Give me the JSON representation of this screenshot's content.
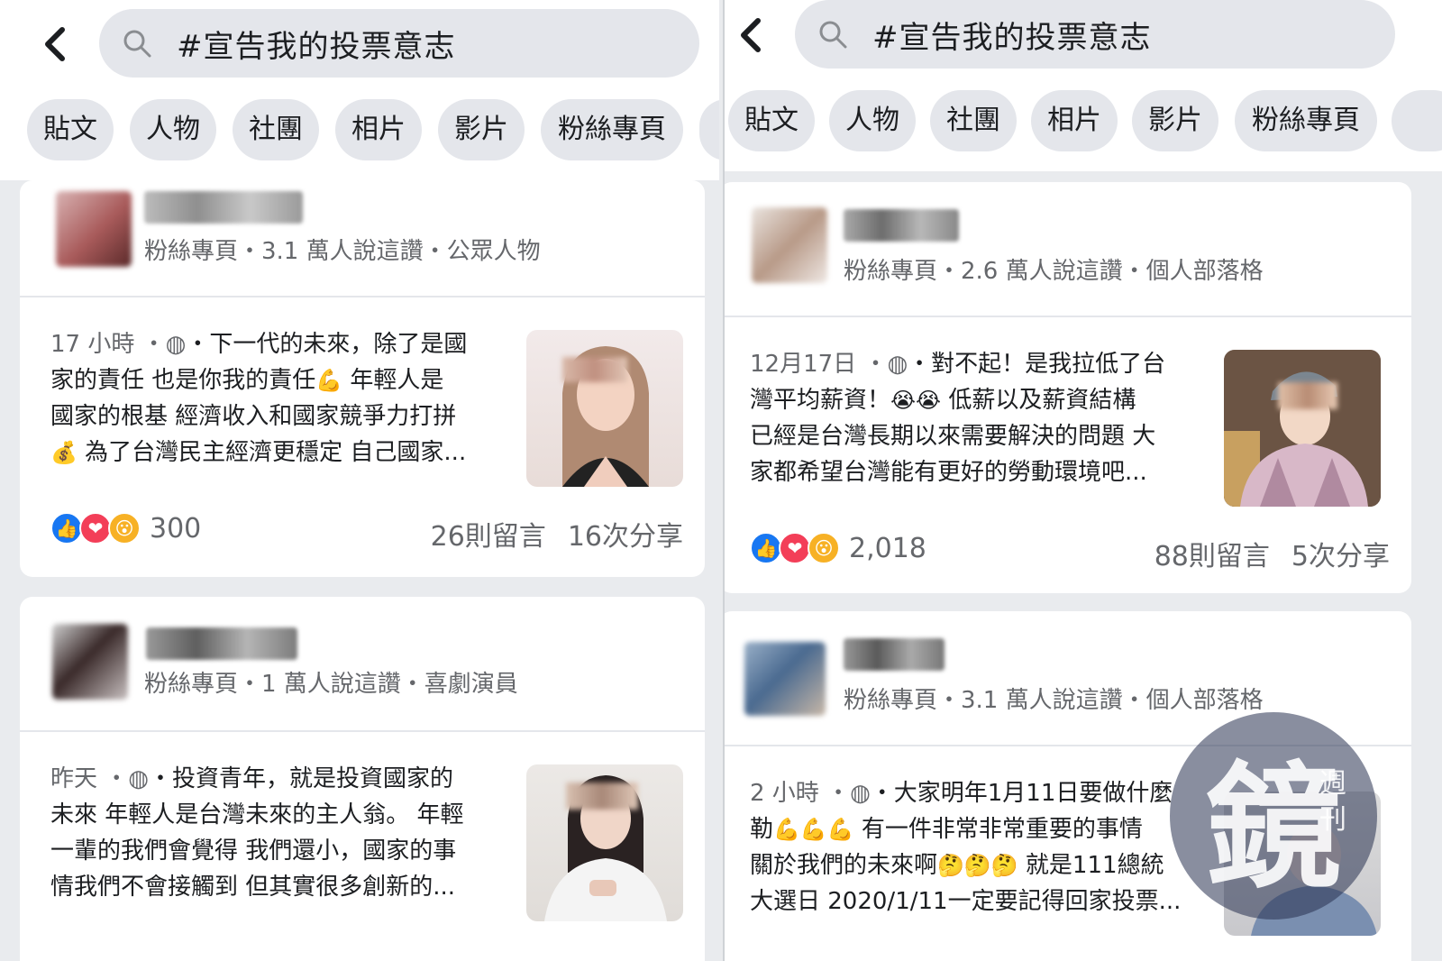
{
  "colors": {
    "page_bg": "#e9ebee",
    "chip_bg": "#e4e6eb",
    "like": "#1877f2",
    "love": "#f33e58",
    "wow": "#f7b125",
    "muted": "#65676b"
  },
  "icons": {
    "back": "back-arrow-icon",
    "search": "search-icon",
    "globe": "globe-icon"
  },
  "left": {
    "search_query": "#宣告我的投票意志",
    "chips": [
      "貼文",
      "人物",
      "社團",
      "相片",
      "影片",
      "粉絲專頁"
    ],
    "results": [
      {
        "page_meta": "粉絲專頁・3.1 萬人說這讚・公眾人物",
        "time": "17 小時",
        "line1": "・下一代的未來，除了是國",
        "line2a": "家的責任 也是你我的責任",
        "line2b": " 年輕人是",
        "line3": "國家的根基 經濟收入和國家競爭力打拼",
        "line4": " 為了台灣民主經濟更穩定 自己國家...",
        "emoji_a": "💪",
        "emoji_b": "💰",
        "reaction_count": "300",
        "comments": "26則留言",
        "shares": "16次分享"
      },
      {
        "page_meta": "粉絲專頁・1 萬人說這讚・喜劇演員",
        "time": "昨天",
        "line1": "・投資青年，就是投資國家的",
        "line2": "未來 年輕人是台灣未來的主人翁。 年輕",
        "line3": "一輩的我們會覺得 我們還小，國家的事",
        "line4": "情我們不會接觸到 但其實很多創新的..."
      }
    ]
  },
  "right": {
    "search_query": "#宣告我的投票意志",
    "chips": [
      "貼文",
      "人物",
      "社團",
      "相片",
      "影片",
      "粉絲專頁"
    ],
    "results": [
      {
        "page_meta": "粉絲專頁・2.6 萬人說這讚・個人部落格",
        "time": "12月17日",
        "line1": "・對不起！是我拉低了台",
        "line2a": "灣平均薪資！",
        "line2b": " 低薪以及薪資結構",
        "line3": "已經是台灣長期以來需要解決的問題 大",
        "line4": "家都希望台灣能有更好的勞動環境吧...",
        "emoji_a": "😭😭",
        "reaction_count": "2,018",
        "comments": "88則留言",
        "shares": "5次分享"
      },
      {
        "page_meta": "粉絲專頁・3.1 萬人說這讚・個人部落格",
        "time": "2 小時",
        "line1": "・大家明年1月11日要做什麼",
        "line2a": "勒",
        "line2b": " 有一件非常非常重要的事情",
        "line3a": "關於我們的未來啊",
        "line3b": " 就是111總統",
        "line4": "大選日 2020/1/11一定要記得回家投票...",
        "emoji_a": "💪💪💪",
        "emoji_b": "🤔🤔🤔"
      }
    ]
  },
  "watermark": {
    "main": "鏡",
    "sub": "週刊"
  }
}
